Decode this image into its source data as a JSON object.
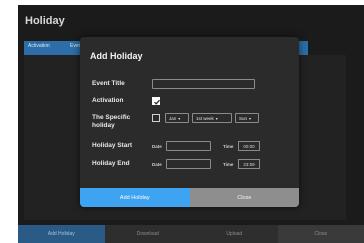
{
  "page": {
    "title": "Holiday",
    "tabs": [
      {
        "label": "Activation"
      },
      {
        "label": "Event"
      }
    ]
  },
  "bottom_bar": {
    "buttons": [
      {
        "label": "Add Holiday"
      },
      {
        "label": "Download"
      },
      {
        "label": "Upload"
      },
      {
        "label": "Close"
      }
    ]
  },
  "modal": {
    "title": "Add Holiday",
    "event_title": {
      "label": "Event Title",
      "value": ""
    },
    "activation": {
      "label": "Activation",
      "checked": true
    },
    "specific": {
      "label_line1": "The Specific",
      "label_line2": "holiday",
      "checked": false,
      "month": "Jan",
      "week": "1st week",
      "day": "Sun"
    },
    "holiday_start": {
      "label": "Holiday Start",
      "date_label": "Date",
      "date_value": "",
      "time_label": "Time",
      "time_value": "00:00"
    },
    "holiday_end": {
      "label": "Holiday End",
      "date_label": "Date",
      "date_value": "",
      "time_label": "Time",
      "time_value": "23:59"
    },
    "footer": {
      "add_label": "Add Holiday",
      "close_label": "Close"
    }
  },
  "colors": {
    "accent": "#3ea3f0",
    "tabbar": "#2d6ea8",
    "modal_bg": "#2b2b2b"
  }
}
